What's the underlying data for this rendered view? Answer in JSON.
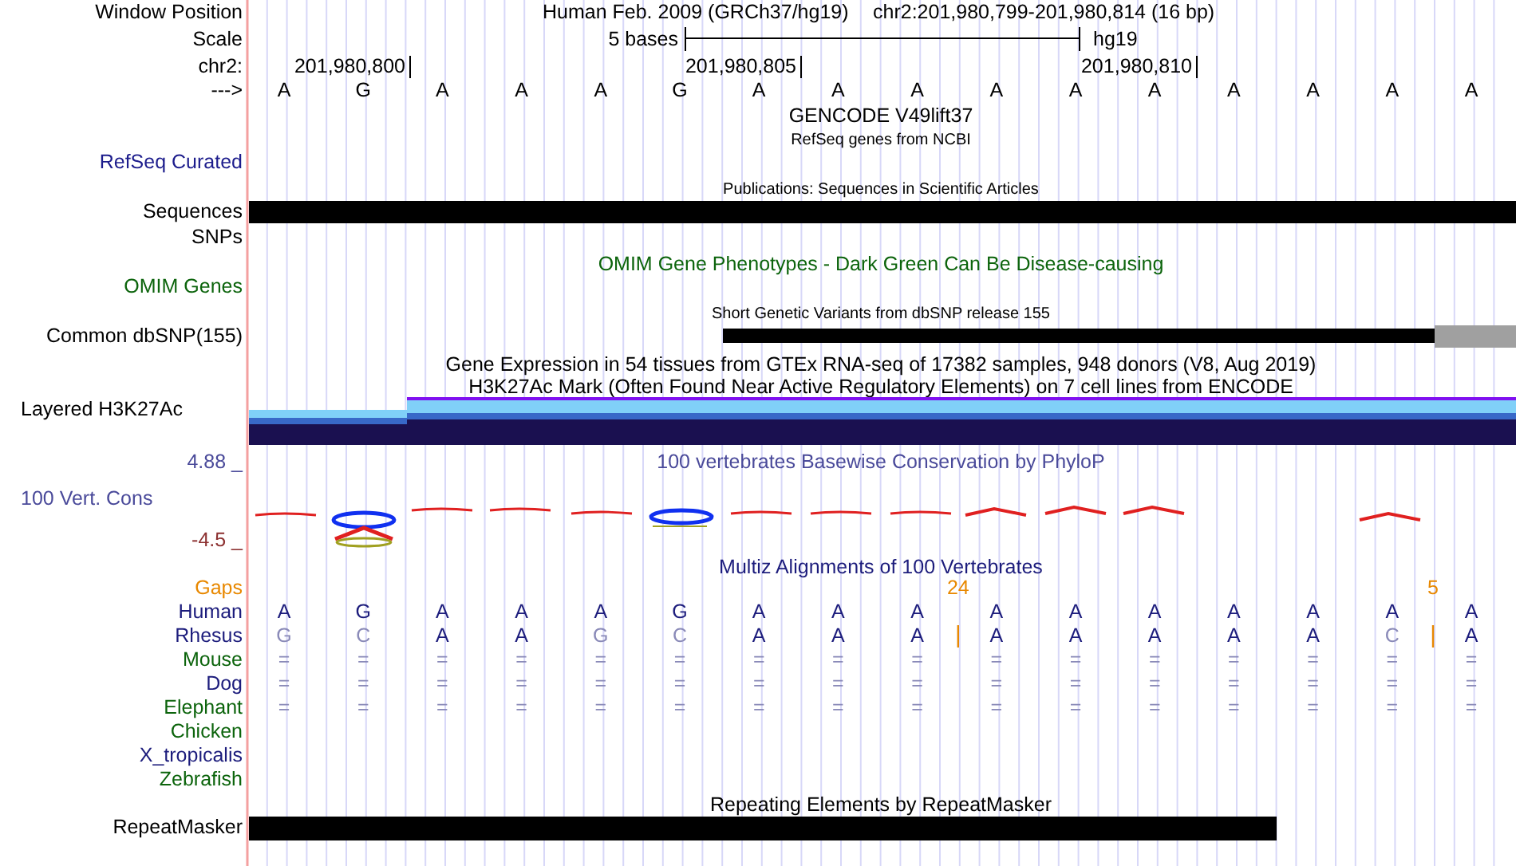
{
  "ruler": {
    "title": "Human Feb. 2009 (GRCh37/hg19)",
    "position": "chr2:201,980,799-201,980,814 (16 bp)",
    "scale_text": "5 bases",
    "scale_assembly": "hg19",
    "ticks": [
      "201,980,800",
      "201,980,805",
      "201,980,810"
    ],
    "bases": [
      "A",
      "G",
      "A",
      "A",
      "A",
      "G",
      "A",
      "A",
      "A",
      "A",
      "A",
      "A",
      "A",
      "A",
      "A",
      "A"
    ]
  },
  "side_labels": [
    {
      "text": "Window Position",
      "color": "#000000"
    },
    {
      "text": "Scale",
      "color": "#000000"
    },
    {
      "text": "chr2:",
      "color": "#000000"
    },
    {
      "text": "--->",
      "color": "#000000"
    },
    {
      "text": "RefSeq Curated",
      "color": "#1c1c8c"
    },
    {
      "text": "Sequences",
      "color": "#000000"
    },
    {
      "text": "SNPs",
      "color": "#000000"
    },
    {
      "text": "OMIM Genes",
      "color": "#0c640c"
    },
    {
      "text": "Common dbSNP(155)",
      "color": "#000000"
    },
    {
      "text": "Layered H3K27Ac",
      "color": "#000000"
    },
    {
      "text": "4.88 _",
      "color": "#4a4a9a"
    },
    {
      "text": "100 Vert. Cons",
      "color": "#4a4a9a"
    },
    {
      "text": "-4.5 _",
      "color": "#8c3030"
    },
    {
      "text": "RepeatMasker",
      "color": "#000000"
    }
  ],
  "track_titles": [
    {
      "text": "GENCODE V49lift37",
      "kind": "large",
      "color": "#000000"
    },
    {
      "text": "RefSeq genes from NCBI",
      "kind": "small",
      "color": "#000000"
    },
    {
      "text": "Publications: Sequences in Scientific Articles",
      "kind": "small",
      "color": "#000000"
    },
    {
      "text": "OMIM Gene Phenotypes - Dark Green Can Be Disease-causing",
      "kind": "large",
      "color": "#0c640c"
    },
    {
      "text": "Short Genetic Variants from dbSNP release 155",
      "kind": "small",
      "color": "#000000"
    },
    {
      "text": "Gene Expression in 54 tissues from GTEx RNA-seq of 17382 samples, 948 donors (V8, Aug 2019)",
      "kind": "large",
      "color": "#000000"
    },
    {
      "text": "H3K27Ac Mark (Often Found Near Active Regulatory Elements) on 7 cell lines from ENCODE",
      "kind": "large",
      "color": "#000000"
    },
    {
      "text": "100 vertebrates Basewise Conservation by PhyloP",
      "kind": "large",
      "color": "#4a4a9a"
    },
    {
      "text": "Multiz Alignments of 100 Vertebrates",
      "kind": "large",
      "color": "#1c1c7c"
    },
    {
      "text": "Repeating Elements by RepeatMasker",
      "kind": "large",
      "color": "#000000"
    }
  ],
  "alignment": {
    "gaps_label": "Gaps",
    "rows": [
      {
        "species": "Human",
        "color": "#1c1c7c",
        "kind": "sequence",
        "bases": [
          {
            "base": "A",
            "match": true
          },
          {
            "base": "G",
            "match": true
          },
          {
            "base": "A",
            "match": true
          },
          {
            "base": "A",
            "match": true
          },
          {
            "base": "A",
            "match": true
          },
          {
            "base": "G",
            "match": true
          },
          {
            "base": "A",
            "match": true
          },
          {
            "base": "A",
            "match": true
          },
          {
            "base": "A",
            "match": true
          },
          {
            "base": "A",
            "match": true
          },
          {
            "base": "A",
            "match": true
          },
          {
            "base": "A",
            "match": true
          },
          {
            "base": "A",
            "match": true
          },
          {
            "base": "A",
            "match": true
          },
          {
            "base": "A",
            "match": true
          },
          {
            "base": "A",
            "match": true
          }
        ]
      },
      {
        "species": "Rhesus",
        "color": "#1c1c7c",
        "kind": "sequence",
        "bases": [
          {
            "base": "G",
            "match": false
          },
          {
            "base": "C",
            "match": false
          },
          {
            "base": "A",
            "match": true
          },
          {
            "base": "A",
            "match": true
          },
          {
            "base": "G",
            "match": false
          },
          {
            "base": "C",
            "match": false
          },
          {
            "base": "A",
            "match": true
          },
          {
            "base": "A",
            "match": true
          },
          {
            "base": "A",
            "match": true
          },
          {
            "base": "A",
            "match": true,
            "gap_before": "24"
          },
          {
            "base": "A",
            "match": true
          },
          {
            "base": "A",
            "match": true
          },
          {
            "base": "A",
            "match": true
          },
          {
            "base": "A",
            "match": true
          },
          {
            "base": "C",
            "match": false
          },
          {
            "base": "A",
            "match": true,
            "gap_before": "5"
          }
        ]
      },
      {
        "species": "Mouse",
        "color": "#0c640c",
        "kind": "summary",
        "marks": [
          "=",
          "=",
          "=",
          "=",
          "=",
          "=",
          "=",
          "=",
          "=",
          "=",
          "=",
          "=",
          "=",
          "=",
          "=",
          "="
        ]
      },
      {
        "species": "Dog",
        "color": "#1c1c7c",
        "kind": "summary",
        "marks": [
          "=",
          "=",
          "=",
          "=",
          "=",
          "=",
          "=",
          "=",
          "=",
          "=",
          "=",
          "=",
          "=",
          "=",
          "=",
          "="
        ]
      },
      {
        "species": "Elephant",
        "color": "#0c640c",
        "kind": "summary",
        "marks": [
          "=",
          "=",
          "=",
          "=",
          "=",
          "=",
          "=",
          "=",
          "=",
          "=",
          "=",
          "=",
          "=",
          "=",
          "=",
          "="
        ]
      },
      {
        "species": "Chicken",
        "color": "#0c640c",
        "kind": "none"
      },
      {
        "species": "X_tropicalis",
        "color": "#1c1c7c",
        "kind": "none"
      },
      {
        "species": "Zebrafish",
        "color": "#0c640c",
        "kind": "none"
      }
    ]
  }
}
